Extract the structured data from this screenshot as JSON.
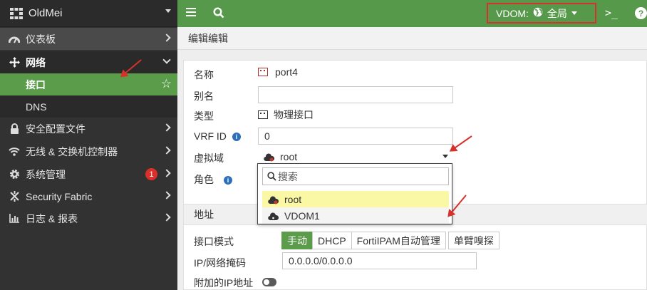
{
  "brand": {
    "name": "OldMei"
  },
  "sidebar": {
    "items": [
      {
        "label": "仪表板",
        "icon": "dashboard-icon"
      },
      {
        "label": "网络",
        "icon": "move-arrows-icon"
      },
      {
        "label": "接口"
      },
      {
        "label": "DNS"
      },
      {
        "label": "安全配置文件",
        "icon": "lock-icon"
      },
      {
        "label": "无线 & 交换机控制器",
        "icon": "wifi-icon"
      },
      {
        "label": "系统管理",
        "icon": "gear-icon",
        "badge": "1"
      },
      {
        "label": "Security Fabric",
        "icon": "fabric-icon"
      },
      {
        "label": "日志 & 报表",
        "icon": "bar-chart-icon"
      }
    ]
  },
  "topbar": {
    "vdom_label": "VDOM:",
    "vdom_value": "全局",
    "cli_glyph": ">_",
    "help_glyph": "?"
  },
  "page": {
    "title": "编辑编辑"
  },
  "form": {
    "name_label": "名称",
    "name_value": "port4",
    "alias_label": "别名",
    "alias_value": "",
    "type_label": "类型",
    "type_value": "物理接口",
    "vrf_label": "VRF ID",
    "vrf_value": "0",
    "vdom_label": "虚拟域",
    "vdom_selected": "root",
    "role_label": "角色",
    "address_section": "地址",
    "mode_label": "接口模式",
    "mode_options": [
      "手动",
      "DHCP",
      "FortiIPAM自动管理",
      "单臂嗅探"
    ],
    "mode_active": "手动",
    "ip_label": "IP/网络掩码",
    "ip_value": "0.0.0.0/0.0.0.0",
    "extra_ip_label": "附加的IP地址"
  },
  "dropdown": {
    "search_placeholder": "搜索",
    "options": [
      "root",
      "VDOM1"
    ]
  },
  "colors": {
    "accent_green": "#57994a",
    "sidebar_bg": "#323232",
    "highlight_red": "#d6322b",
    "selected_yellow": "#fbf8a5"
  }
}
